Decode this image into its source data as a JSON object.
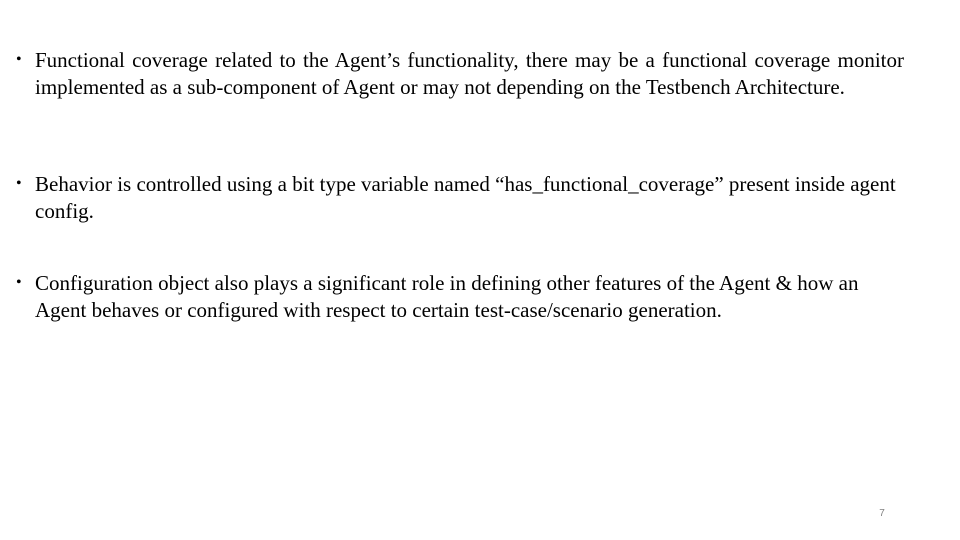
{
  "slide": {
    "bullets": [
      {
        "symbol": "•",
        "text": "Functional coverage related to the Agent’s functionality, there may be a functional coverage monitor implemented as a sub-component of Agent or may not depending  on the Testbench Architecture."
      },
      {
        "symbol": "•",
        "text": "Behavior is controlled using a bit type variable named “has_functional_coverage” present inside agent config."
      },
      {
        "symbol": "•",
        "text": "Configuration object also plays a significant role in defining other features of the Agent & how an Agent behaves or configured with respect to certain test-case/scenario generation."
      }
    ],
    "page_number": "7"
  }
}
